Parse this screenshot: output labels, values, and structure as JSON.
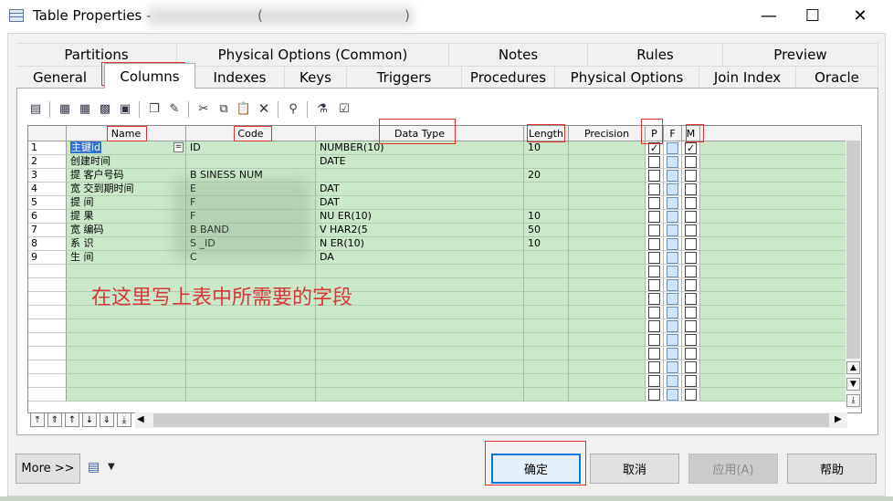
{
  "window": {
    "title": "Table Properties - ",
    "title_tail": ")",
    "title_open_paren": "(",
    "minimize_glyph": "—",
    "maximize_glyph": "☐",
    "close_glyph": "✕"
  },
  "tabs_row1": [
    {
      "label": "Partitions"
    },
    {
      "label": "Physical Options (Common)"
    },
    {
      "label": "Notes"
    },
    {
      "label": "Rules"
    },
    {
      "label": "Preview"
    }
  ],
  "tabs_row2": [
    {
      "label": "General"
    },
    {
      "label": "Columns",
      "active": true
    },
    {
      "label": "Indexes"
    },
    {
      "label": "Keys"
    },
    {
      "label": "Triggers"
    },
    {
      "label": "Procedures"
    },
    {
      "label": "Physical Options"
    },
    {
      "label": "Join Index"
    },
    {
      "label": "Oracle"
    }
  ],
  "toolbar_icons": [
    "properties-icon",
    "add-row-icon",
    "insert-row-icon",
    "add-columns-icon",
    "column-group-icon",
    "copy-list-icon",
    "paste-list-icon",
    "cut-icon",
    "copy-icon",
    "paste-icon",
    "delete-icon",
    "find-icon",
    "filter-icon",
    "customize-columns-icon"
  ],
  "grid": {
    "headers": {
      "name": "Name",
      "code": "Code",
      "data_type": "Data Type",
      "length": "Length",
      "precision": "Precision",
      "p": "P",
      "f": "F",
      "m": "M"
    },
    "rows": [
      {
        "num": "1",
        "name": "主键id",
        "code": "ID",
        "type": "NUMBER(10)",
        "length": "10",
        "p": true,
        "m": true
      },
      {
        "num": "2",
        "name": "创建时间",
        "code": "",
        "type": "DATE",
        "length": "",
        "p": false,
        "m": false
      },
      {
        "num": "3",
        "name": "提  客户号码",
        "code": "B  SINESS  NUM",
        "type": "",
        "length": "20",
        "p": false,
        "m": false
      },
      {
        "num": "4",
        "name": "宽  交到期时间",
        "code": "E",
        "type": "DAT",
        "length": "",
        "p": false,
        "m": false
      },
      {
        "num": "5",
        "name": "提  间",
        "code": "F",
        "type": "DAT",
        "length": "",
        "p": false,
        "m": false
      },
      {
        "num": "6",
        "name": "提  果",
        "code": "F",
        "type": "NU  ER(10)",
        "length": "10",
        "p": false,
        "m": false
      },
      {
        "num": "7",
        "name": "宽  编码",
        "code": "B  BAND",
        "type": "V  HAR2(5",
        "length": "50",
        "p": false,
        "m": false
      },
      {
        "num": "8",
        "name": "系  识",
        "code": "S  _ID",
        "type": "N  ER(10)",
        "length": "10",
        "p": false,
        "m": false
      },
      {
        "num": "9",
        "name": "生  间",
        "code": "C",
        "type": "DA",
        "length": "",
        "p": false,
        "m": false
      }
    ],
    "empty_rows": 10,
    "name_dropdown_glyph": "="
  },
  "annotation": "在这里写上表中所需要的字段",
  "nav_buttons": [
    "⤒",
    "⇑",
    "↑",
    "↓",
    "⇓",
    "⤓"
  ],
  "footer": {
    "more_label": "More >>",
    "ok_label": "确定",
    "cancel_label": "取消",
    "apply_label": "应用(A)",
    "help_label": "帮助"
  },
  "colors": {
    "row_green": "#cbe8cb",
    "selection_blue": "#3470d0",
    "annotation_red": "#d23a3a",
    "default_button_border": "#0078d7"
  }
}
